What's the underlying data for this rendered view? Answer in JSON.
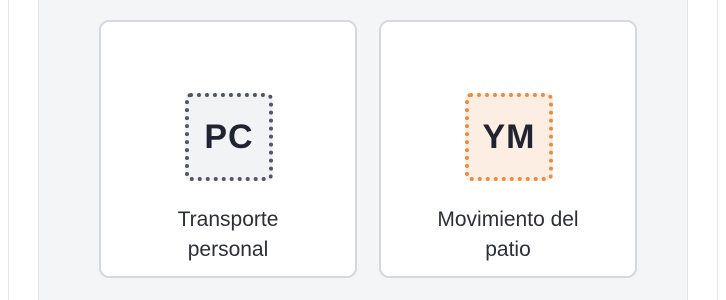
{
  "cards": [
    {
      "code": "PC",
      "label_line1": "Transporte",
      "label_line2": "personal",
      "icon": "pc-badge-icon",
      "border_color": "#4e5667",
      "bg_color": "#f2f3f5"
    },
    {
      "code": "YM",
      "label_line1": "Movimiento del",
      "label_line2": "patio",
      "icon": "ym-badge-icon",
      "border_color": "#ef8a3f",
      "bg_color": "#fdeee3"
    }
  ]
}
